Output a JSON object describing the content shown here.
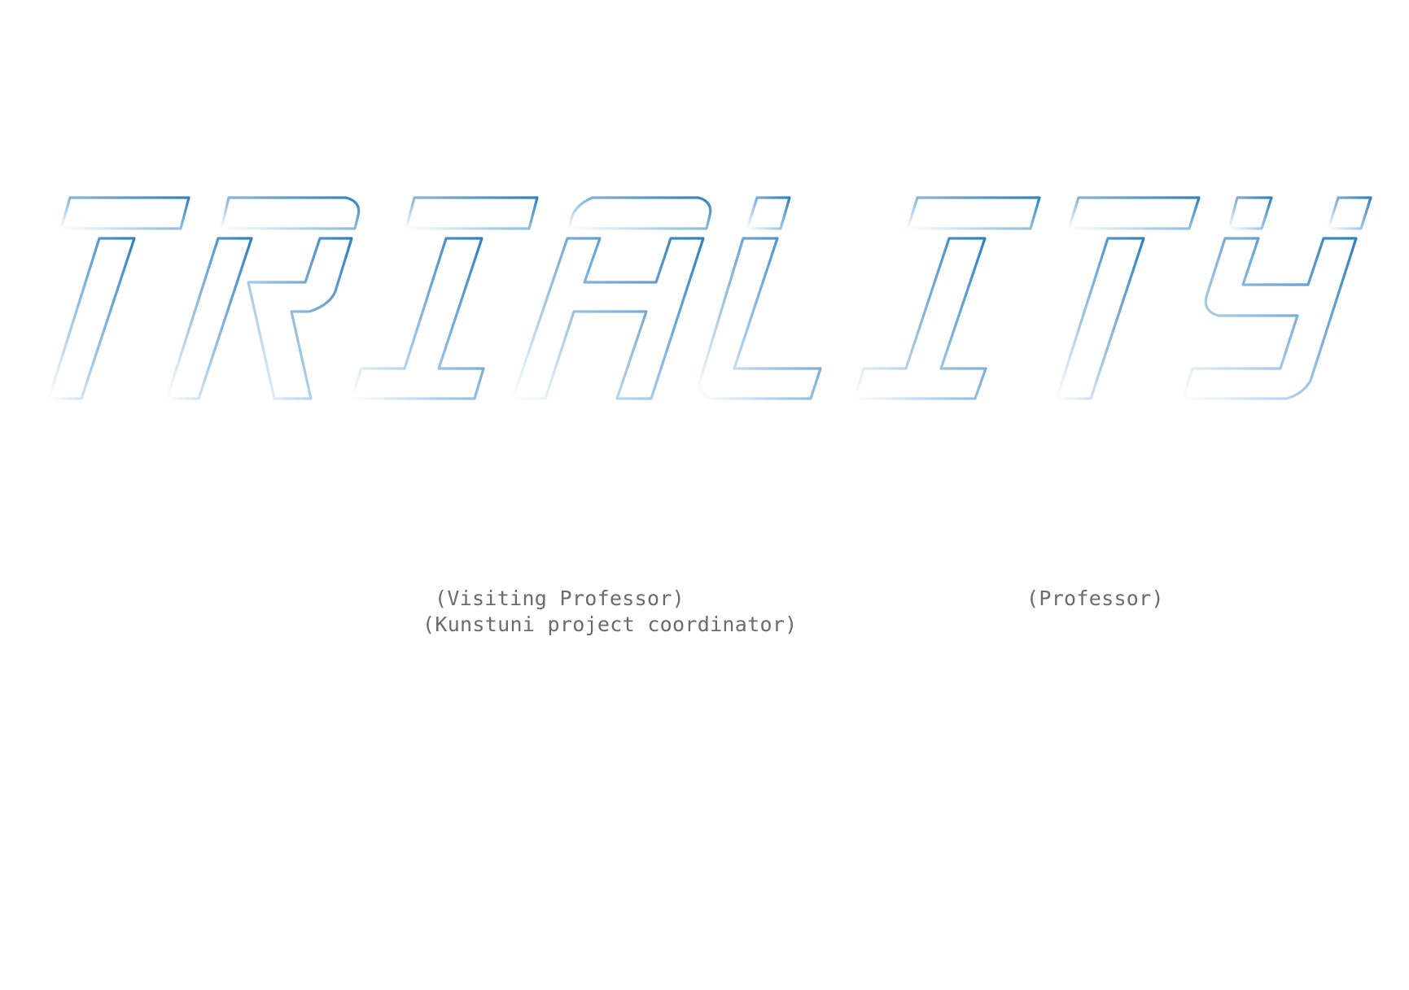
{
  "title": {
    "text": "TRIALITY",
    "letters": [
      "T",
      "R",
      "I",
      "A",
      "L",
      "I",
      "T",
      "Y"
    ],
    "colors": {
      "accent": "#2f80c0",
      "fade": "#e6f0f8"
    }
  },
  "roles": {
    "visiting_professor": "(Visiting Professor)",
    "project_coordinator": "(Kunstuni project coordinator)",
    "professor": "(Professor)"
  }
}
